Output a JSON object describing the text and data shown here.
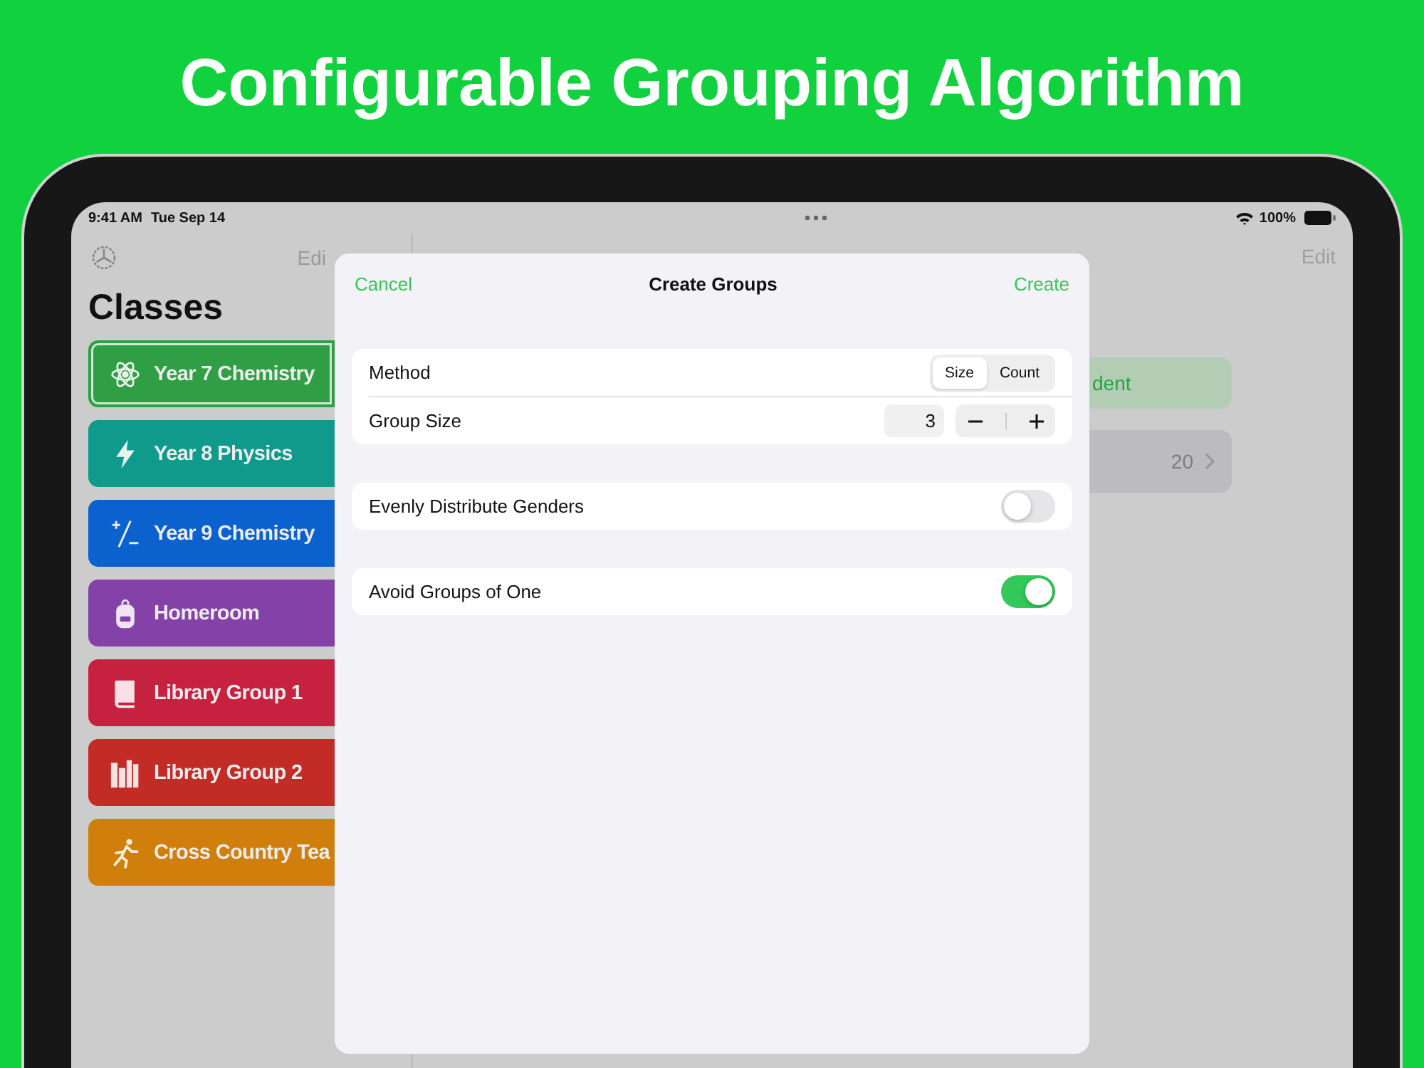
{
  "headline": "Configurable Grouping Algorithm",
  "status_bar": {
    "time": "9:41 AM",
    "date": "Tue Sep 14",
    "battery": "100%"
  },
  "sidebar": {
    "edit_label": "Edi",
    "title": "Classes",
    "items": [
      {
        "label": "Year 7 Chemistry",
        "color": "#2f9e44",
        "selected": true
      },
      {
        "label": "Year 8 Physics",
        "color": "#109a8c",
        "selected": false
      },
      {
        "label": "Year 9 Chemistry",
        "color": "#0b62cf",
        "selected": false
      },
      {
        "label": "Homeroom",
        "color": "#8442a8",
        "selected": false
      },
      {
        "label": "Library Group 1",
        "color": "#c6223f",
        "selected": false
      },
      {
        "label": "Library Group 2",
        "color": "#c22b26",
        "selected": false
      },
      {
        "label": "Cross Country Tea",
        "color": "#d07f0c",
        "selected": false
      }
    ]
  },
  "detail": {
    "edit_label": "Edit",
    "button_label": "dent",
    "row_value": "20"
  },
  "sheet": {
    "cancel": "Cancel",
    "title": "Create Groups",
    "create": "Create",
    "method": {
      "label": "Method",
      "options": [
        {
          "label": "Size",
          "selected": true
        },
        {
          "label": "Count",
          "selected": false
        }
      ]
    },
    "group_size": {
      "label": "Group Size",
      "value": "3"
    },
    "toggles": [
      {
        "label": "Evenly Distribute Genders",
        "on": false
      },
      {
        "label": "Avoid Groups of One",
        "on": true
      }
    ]
  }
}
